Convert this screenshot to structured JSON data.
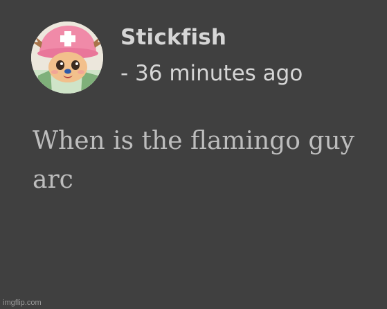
{
  "post": {
    "author": {
      "name": "Stickfish",
      "avatar_icon": "chopper-avatar-icon"
    },
    "timestamp": "- 36 minutes ago",
    "text": "When is the flamingo guy arc"
  },
  "watermark": "imgflip.com",
  "colors": {
    "background": "#404040",
    "name_text": "#d6d6d6",
    "body_text": "#bdbdbd",
    "avatar_hat": "#f08aa8"
  }
}
